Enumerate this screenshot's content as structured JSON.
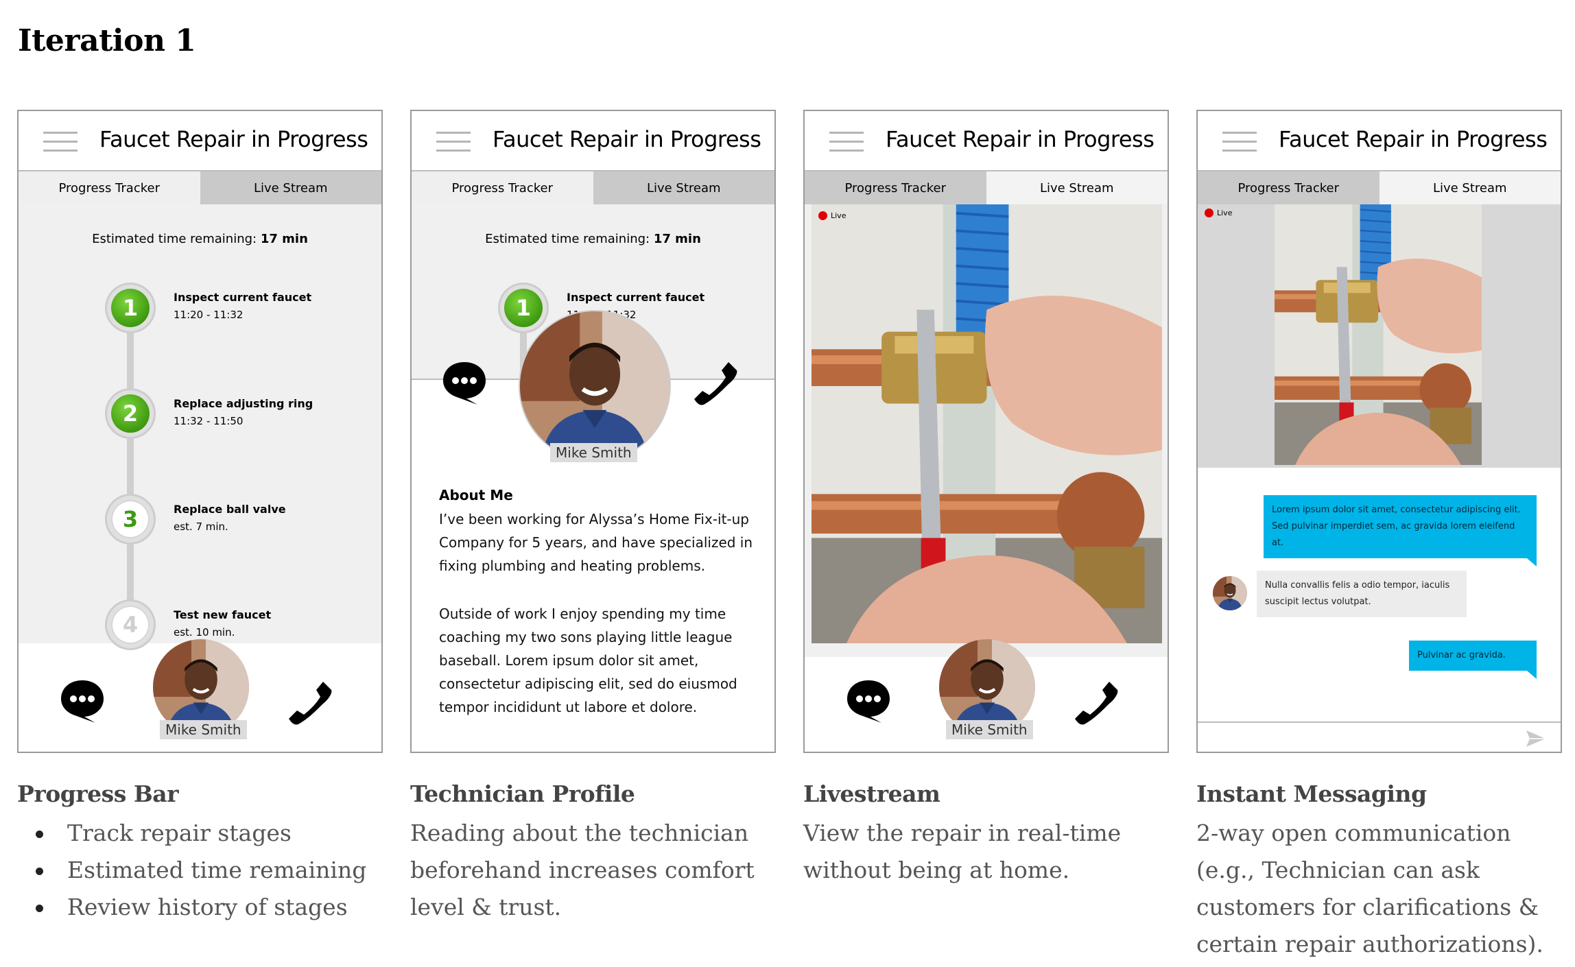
{
  "page": {
    "title": "Iteration 1"
  },
  "app": {
    "header_title": "Faucet Repair in Progress",
    "tab_progress": "Progress Tracker",
    "tab_live": "Live Stream",
    "eta_label": "Estimated time remaining: ",
    "eta_value": "17 min",
    "technician_name": "Mike Smith"
  },
  "steps": [
    {
      "number": "1",
      "title": "Inspect current faucet",
      "time": "11:20 - 11:32",
      "state": "done"
    },
    {
      "number": "2",
      "title": "Replace adjusting ring",
      "time": "11:32 - 11:50",
      "state": "done"
    },
    {
      "number": "3",
      "title": "Replace ball valve",
      "time": "est. 7 min.",
      "state": "next"
    },
    {
      "number": "4",
      "title": "Test new faucet",
      "time": "est. 10 min.",
      "state": "future"
    }
  ],
  "profile": {
    "about_heading": "About Me",
    "about_p1": "I’ve been working for Alyssa’s Home Fix-it-up Company for 5 years, and have specialized in fixing plumbing and heating problems.",
    "about_p2": "Outside of work I enjoy spending my time coaching my two sons playing little league baseball. Lorem ipsum dolor sit amet, consectetur adipiscing elit, sed do eiusmod tempor incididunt ut labore et dolore."
  },
  "live": {
    "badge": "Live"
  },
  "messages": [
    {
      "from": "me",
      "text": "Lorem ipsum dolor sit amet, consectetur adipiscing elit. Sed pulvinar imperdiet sem, ac gravida lorem eleifend at."
    },
    {
      "from": "technician",
      "text": "Nulla convallis felis a odio tempor, iaculis suscipit lectus volutpat."
    },
    {
      "from": "me",
      "text": "Pulvinar ac gravida."
    }
  ],
  "captions": {
    "c1_title": "Progress Bar",
    "c1_items": [
      "Track repair stages",
      "Estimated time remaining",
      "Review history of stages"
    ],
    "c2_title": "Technician Profile",
    "c2_text": "Reading about the technician beforehand increases comfort level & trust.",
    "c3_title": "Livestream",
    "c3_text": "View the repair in real-time without being at home.",
    "c4_title": "Instant Messaging",
    "c4_text": "2-way open communication (e.g., Technician can ask customers for clarifications & certain repair authorizations)."
  },
  "icons": [
    "hamburger-icon",
    "chat-bubble-icon",
    "phone-icon",
    "send-icon",
    "live-dot-icon"
  ],
  "colors": {
    "accent_green": "#3f9a11",
    "message_blue": "#00b4e8",
    "live_red": "#e00000"
  }
}
